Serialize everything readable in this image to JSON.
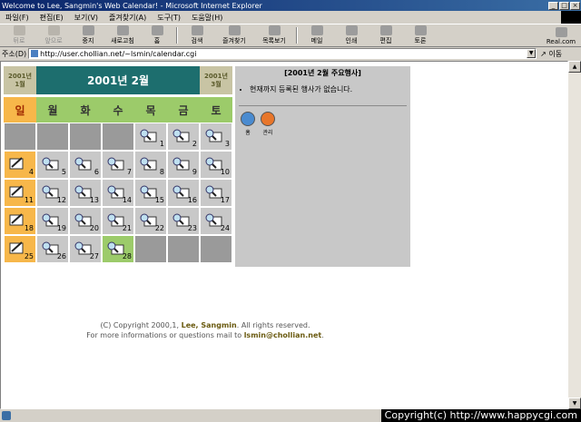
{
  "window": {
    "title": "Welcome to Lee, Sangmin's Web Calendar! - Microsoft Internet Explorer",
    "buttons": [
      "_",
      "□",
      "×"
    ]
  },
  "menu": [
    "파일(F)",
    "편집(E)",
    "보기(V)",
    "즐겨찾기(A)",
    "도구(T)",
    "도움말(H)"
  ],
  "toolbar": [
    {
      "label": "뒤로",
      "icon": "back-arrow-icon",
      "disabled": true
    },
    {
      "label": "앞으로",
      "icon": "forward-arrow-icon",
      "disabled": true
    },
    {
      "label": "중지",
      "icon": "stop-icon"
    },
    {
      "label": "새로고침",
      "icon": "refresh-icon"
    },
    {
      "label": "홈",
      "icon": "home-icon"
    },
    {
      "label": "검색",
      "icon": "search-icon"
    },
    {
      "label": "즐겨찾기",
      "icon": "favorites-icon"
    },
    {
      "label": "목록보기",
      "icon": "history-icon"
    },
    {
      "label": "메일",
      "icon": "mail-icon"
    },
    {
      "label": "인쇄",
      "icon": "print-icon"
    },
    {
      "label": "편집",
      "icon": "edit-icon"
    },
    {
      "label": "토론",
      "icon": "discuss-icon"
    },
    {
      "label": "Real.com",
      "icon": "real-icon"
    }
  ],
  "address": {
    "label": "주소(D)",
    "url": "http://user.chollian.net/~lsmin/calendar.cgi",
    "go_label": "이동"
  },
  "calendar": {
    "prev_label": [
      "2001년",
      "1월"
    ],
    "month_title": "2001년 2월",
    "next_label": [
      "2001년",
      "3월"
    ],
    "weekdays": [
      "일",
      "월",
      "화",
      "수",
      "목",
      "금",
      "토"
    ],
    "days": [
      "",
      "",
      "",
      "",
      "1",
      "2",
      "3",
      "4",
      "5",
      "6",
      "7",
      "8",
      "9",
      "10",
      "11",
      "12",
      "13",
      "14",
      "15",
      "16",
      "17",
      "18",
      "19",
      "20",
      "21",
      "22",
      "23",
      "24",
      "25",
      "26",
      "27",
      "28",
      "",
      "",
      ""
    ],
    "today": "28"
  },
  "events": {
    "title": "[2001년 2월 주요행사]",
    "empty_message": "현재까지 등록된 행사가 없습니다.",
    "home_label": "홈",
    "admin_label": "관리"
  },
  "footer": {
    "line1_prefix": "(C) Copyright 2000,1,",
    "author": "Lee, Sangmin",
    "line1_suffix": ". All rights reserved.",
    "line2_prefix": "For more informations or questions mail to",
    "email": "lsmin@chollian.net",
    "line2_suffix": "."
  },
  "status": {
    "copyright": "Copyright(c) http://www.happycgi.com"
  },
  "colors": {
    "title_bar": "#0a246a",
    "month_header": "#1d6e6e",
    "sunday": "#f7b74a",
    "weekday_header": "#9ccb6a",
    "empty_day": "#9a9a9a",
    "day_cell": "#c8c8c8"
  }
}
